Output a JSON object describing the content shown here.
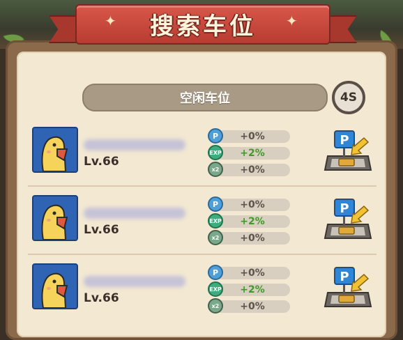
{
  "header": {
    "title": "搜索车位"
  },
  "section": {
    "title": "空闲车位",
    "timer": "4S"
  },
  "icons": {
    "stat_1": "parking-coin-icon",
    "stat_2": "exp-icon",
    "stat_3": "double-reward-icon",
    "action": "parking-lot-icon"
  },
  "colors": {
    "ribbon": "#b83c31",
    "panel": "#f3e8d2",
    "positive": "#3f9a2a"
  },
  "rows": [
    {
      "level": "Lv.66",
      "stats": [
        "+0%",
        "+2%",
        "+0%"
      ]
    },
    {
      "level": "Lv.66",
      "stats": [
        "+0%",
        "+2%",
        "+0%"
      ]
    },
    {
      "level": "Lv.66",
      "stats": [
        "+0%",
        "+2%",
        "+0%"
      ]
    }
  ]
}
